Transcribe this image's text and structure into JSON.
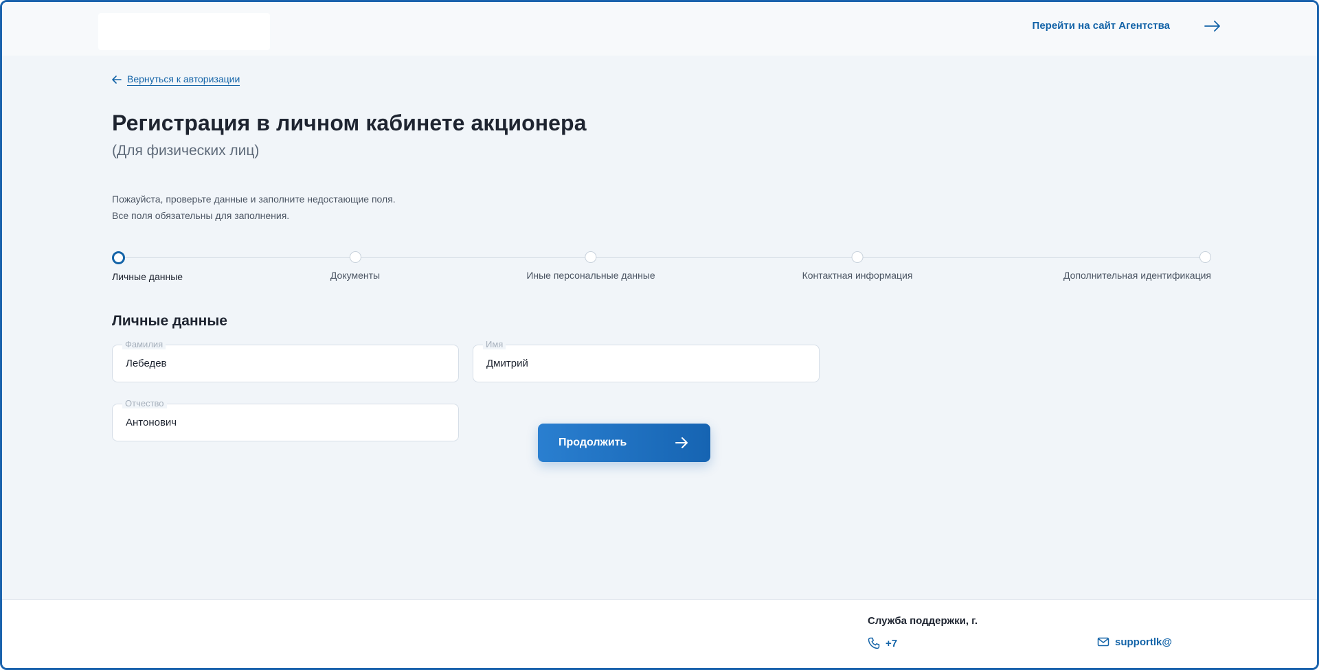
{
  "header": {
    "agency_link": "Перейти на сайт Агентства"
  },
  "nav": {
    "back_link": "Вернуться к авторизации"
  },
  "page": {
    "title": "Регистрация в личном кабинете акционера",
    "subtitle": "(Для физических лиц)",
    "hint_line1": "Пожауйста, проверьте данные и заполните недостающие поля.",
    "hint_line2": "Все поля обязательны для заполнения."
  },
  "stepper": {
    "active_index": 0,
    "steps": [
      {
        "label": "Личные данные"
      },
      {
        "label": "Документы"
      },
      {
        "label": "Иные персональные данные"
      },
      {
        "label": "Контактная информация"
      },
      {
        "label": "Дополнительная идентификация"
      }
    ]
  },
  "form": {
    "section_title": "Личные данные",
    "fields": {
      "last_name": {
        "label": "Фамилия",
        "value": "Лебедев"
      },
      "first_name": {
        "label": "Имя",
        "value": "Дмитрий"
      },
      "patronymic": {
        "label": "Отчество",
        "value": "Антонович"
      }
    },
    "continue_label": "Продолжить"
  },
  "footer": {
    "support_title": "Служба поддержки, г.",
    "phone": "+7",
    "email": "supportlk@"
  },
  "colors": {
    "accent": "#1464a8",
    "button": "#1e70c0",
    "background": "#f1f5f9"
  }
}
